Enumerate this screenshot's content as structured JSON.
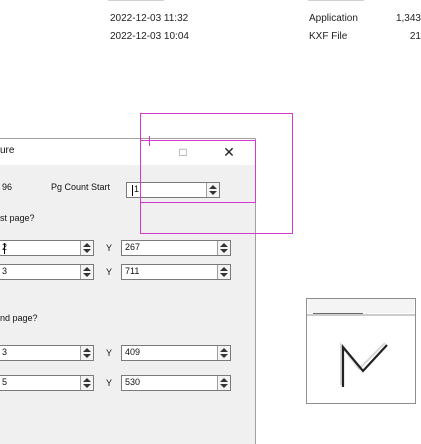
{
  "file_list": {
    "rows": [
      {
        "date": "2022-12-03 11:32",
        "type": "Application",
        "size": "1,343"
      },
      {
        "date": "2022-12-03 10:04",
        "type": "KXF File",
        "size": "21"
      }
    ]
  },
  "dialog": {
    "title_partial": "ure",
    "minimize_icon": "□",
    "close_icon": "✕",
    "pg_count_row": {
      "left_value": "96",
      "label": "Pg Count Start",
      "value": "1"
    },
    "first_section_label": "st page?",
    "first_rows": [
      {
        "x_value": "2",
        "y_label": "Y",
        "y_value": "267"
      },
      {
        "x_value": "3",
        "y_label": "Y",
        "y_value": "711"
      }
    ],
    "second_section_label": "nd page?",
    "second_rows": [
      {
        "x_value": "3",
        "y_label": "Y",
        "y_value": "409"
      },
      {
        "x_value": "5",
        "y_label": "Y",
        "y_value": "530"
      }
    ]
  },
  "colors": {
    "selection": "#d23ad2",
    "dialog_bg": "#f0f0f0"
  }
}
